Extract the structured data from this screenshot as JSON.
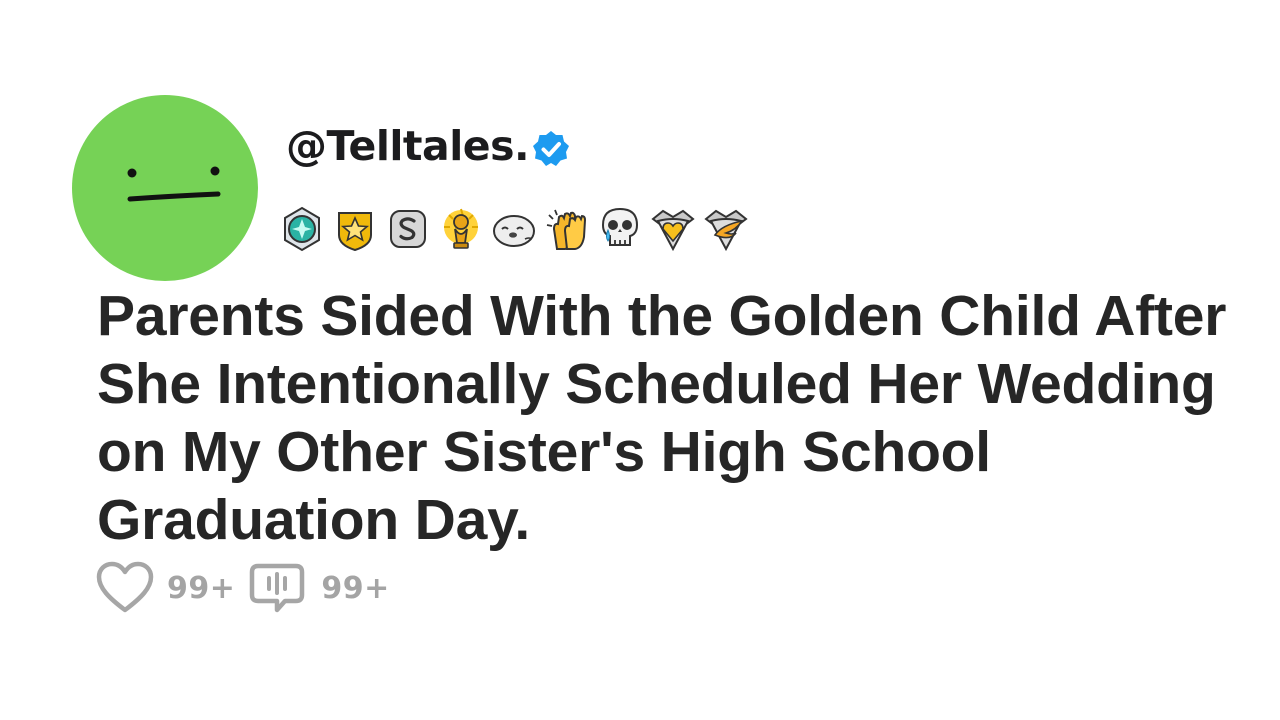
{
  "post": {
    "handle": "@Telltales.",
    "title": "Parents Sided With the Golden Child After She Intentionally Scheduled Her Wedding on My Other Sister's High School Graduation Day.",
    "likes": "99+",
    "comments": "99+"
  },
  "icons": {
    "avatar": "straight-face-icon",
    "verified": "verified-check-icon",
    "like": "heart-icon",
    "comment": "comment-bubble-icon",
    "badges": [
      "teal-gem-shield-icon",
      "gold-star-badge-icon",
      "silver-s-badge-icon",
      "gold-trophy-icon",
      "seal-face-icon",
      "clapping-hands-icon",
      "crying-skull-icon",
      "gold-heart-shield-icon",
      "winged-shield-icon"
    ]
  },
  "colors": {
    "avatar_bg": "#76d256",
    "verified": "#1d9bf0",
    "text": "#262626",
    "muted": "#a4a4a4"
  }
}
